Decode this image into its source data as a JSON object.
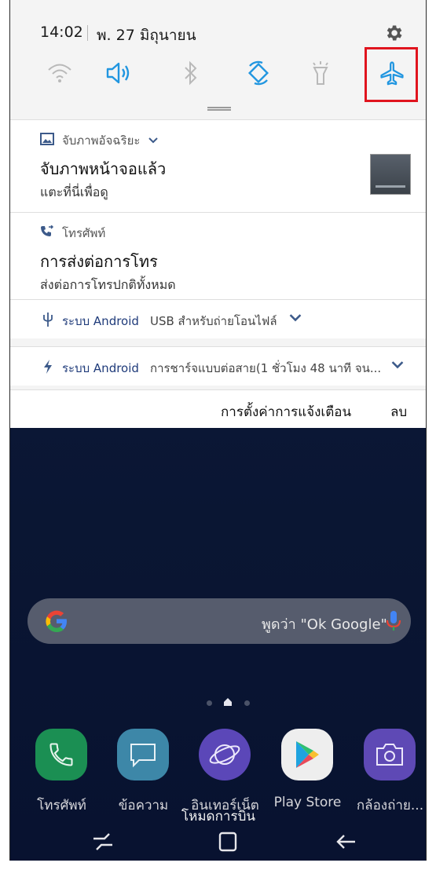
{
  "status_bar": {
    "time": "14:02",
    "date": "พ. 27 มิถุนายน"
  },
  "quick_settings": [
    {
      "name": "wifi",
      "active": false
    },
    {
      "name": "sound",
      "active": true
    },
    {
      "name": "bluetooth",
      "active": false
    },
    {
      "name": "auto-rotate",
      "active": true
    },
    {
      "name": "flashlight",
      "active": false
    },
    {
      "name": "airplane-mode",
      "active": true,
      "highlighted": true
    }
  ],
  "notifications": {
    "screenshot": {
      "app": "จับภาพอัจฉริยะ",
      "title": "จับภาพหน้าจอแล้ว",
      "text": "แตะที่นี่เพื่อดู"
    },
    "phone": {
      "app": "โทรศัพท์",
      "title": "การส่งต่อการโทร",
      "text": "ส่งต่อการโทรปกติทั้งหมด"
    },
    "usb": {
      "app": "ระบบ Android",
      "text": "USB สำหรับถ่ายโอนไฟล์"
    },
    "charging": {
      "app": "ระบบ Android",
      "text": "การชาร์จแบบต่อสาย(1 ชั่วโมง 48 นาที จน..."
    }
  },
  "footer": {
    "settings_label": "การตั้งค่าการแจ้งเตือน",
    "clear_label": "ลบ"
  },
  "search": {
    "hint": "พูดว่า \"Ok Google\""
  },
  "dock": [
    {
      "label": "โทรศัพท์",
      "icon": "phone-icon",
      "color": "#1fa55f"
    },
    {
      "label": "ข้อความ",
      "icon": "message-icon",
      "color": "#3a92b6"
    },
    {
      "label": "อินเทอร์เน็ต",
      "icon": "internet-icon",
      "color": "#6a4fd0"
    },
    {
      "label": "Play Store",
      "icon": "play-store-icon",
      "color": "#f4f4f4"
    },
    {
      "label": "กล้องถ่าย...",
      "icon": "camera-icon",
      "color": "#6a52c8"
    }
  ],
  "toast": "โหมดการบิน",
  "colors": {
    "accent": "#2196e0",
    "highlight_box": "#e0141e",
    "wallpaper": "#0d1838"
  }
}
